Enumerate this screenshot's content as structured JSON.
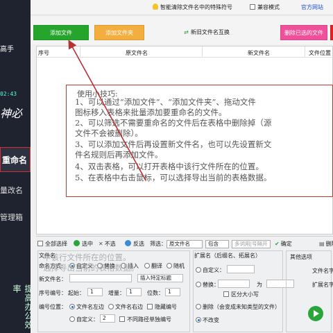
{
  "sidebar": {
    "brand_tail": "高手",
    "time": "02:43",
    "logo_text": "神必",
    "items": [
      {
        "label": "重命名",
        "active": true
      },
      {
        "label": "量改名",
        "active": false
      },
      {
        "label": "管理箱",
        "active": false
      }
    ],
    "slogan": "提高办公效率"
  },
  "topbar": {
    "hint": "智能清除文件名中的特殊符号",
    "compat_mode": "兼容模式",
    "official_site": "官方网站"
  },
  "toolbar": {
    "add_file": "添加文件",
    "add_folder": "添加文件夹",
    "swap_names": "新旧文件名互换",
    "delete_selected": "删除已选的文件"
  },
  "table": {
    "columns": [
      "序号",
      "原文件名",
      "新文件名",
      "文件位置"
    ]
  },
  "tips": {
    "title": "使用小技巧:",
    "lines": [
      "1、可以通过“添加文件”、“添加文件夹”、拖动文件",
      "图标移入表格来批量添加要重命名的文件。",
      "2、可以筛选不需要重命名的文件后在表格中删除掉（源",
      "文件不会被删除）。",
      "3、可以添加文件后再设置新文件名，也可以先设置新文",
      "件名规则后再添加文件。",
      "4、双击表格，可以打开表格中该行文件所在的位置。",
      "5、在表格中右击鼠标，可以选择导出当前的表格数据。"
    ]
  },
  "controls": {
    "select_all": "全部选择",
    "select": "选中",
    "deselect": "不选",
    "invert": "反选",
    "filter_label": "筛选：",
    "filter_field": "原文件名",
    "filter_op": "包含",
    "filter_placeholder": "多词用|号隔开",
    "confirm": "确定",
    "delete": "删除"
  },
  "filename_group": {
    "title": "文件名",
    "naming_label": "命名方式:",
    "naming_options": [
      "自定义",
      "替换",
      "插入",
      "翻译",
      "随机"
    ],
    "naming_selected": "自定义",
    "new_name_label": "新文件名：",
    "insert_special": "插入特定标题",
    "numbering_label": "序号编号：",
    "start_label": "起始：",
    "start_value": "1",
    "step_label": "增量：",
    "step_value": "1",
    "digits_label": "位数：",
    "digits_value": "1",
    "num_pos_label": "编号位置：",
    "num_pos_options": [
      "文件名左边",
      "文件名右边",
      "隐藏编号"
    ],
    "num_pos_selected": "文件名左边",
    "custom_label": "自定义：",
    "custom_value": "2",
    "no_auto": "不同路径单独编号"
  },
  "ext_group": {
    "title": "扩展名（后缀名、拓展名）",
    "custom": "自定义：",
    "replace": "替换：",
    "replace_to": "为",
    "case_sensitive": "区分大小写",
    "delete": "删除（会变成未知类型的文件）",
    "keep": "不改变",
    "selected": "不改变"
  },
  "other_group": {
    "title": "其他选项",
    "label1": "文件名字",
    "label2": "扩展名字"
  },
  "ghost": {
    "line1": "中该行文件所在的位置。",
    "line2": "选择导出当前的表格数据。"
  }
}
